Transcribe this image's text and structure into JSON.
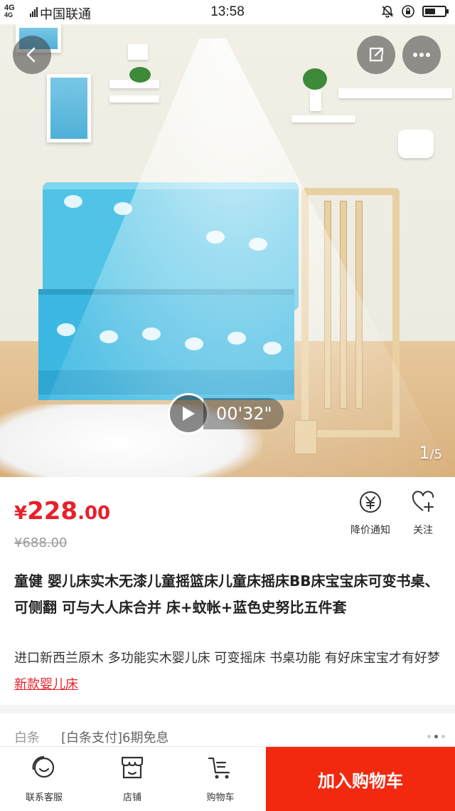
{
  "status_bar": {
    "network_top": "4G",
    "network_bottom": "4G",
    "carrier": "中国联通",
    "time": "13:58",
    "battery_level": 0.55
  },
  "gallery": {
    "video_duration": "00'32\"",
    "current_index": "1",
    "total": "/5"
  },
  "top_buttons": {
    "back_icon": "back-arrow-icon",
    "share_icon": "share-icon",
    "more_icon": "more-icon"
  },
  "product": {
    "price_symbol": "¥",
    "price_integer": "228",
    "price_decimal": ".00",
    "original_price": "¥688.00",
    "title": "童健 婴儿床实木无漆儿童摇篮床儿童床摇床BB床宝宝床可变书桌、可侧翻 可与大人床合并 床+蚊帐+蓝色史努比五件套",
    "subtitle": "进口新西兰原木 多功能实木婴儿床 可变摇床 书桌功能 有好床宝宝才有好梦",
    "subtitle_link": "新款婴儿床"
  },
  "actions": {
    "price_alert": "降价通知",
    "follow": "关注"
  },
  "credit": {
    "label": "白条",
    "text": "[白条支付]6期免息"
  },
  "bottom_bar": {
    "service": "联系客服",
    "shop": "店铺",
    "cart": "购物车",
    "add_to_cart": "加入购物车"
  },
  "colors": {
    "accent_red": "#e8202a",
    "cart_button": "#f2290f"
  }
}
